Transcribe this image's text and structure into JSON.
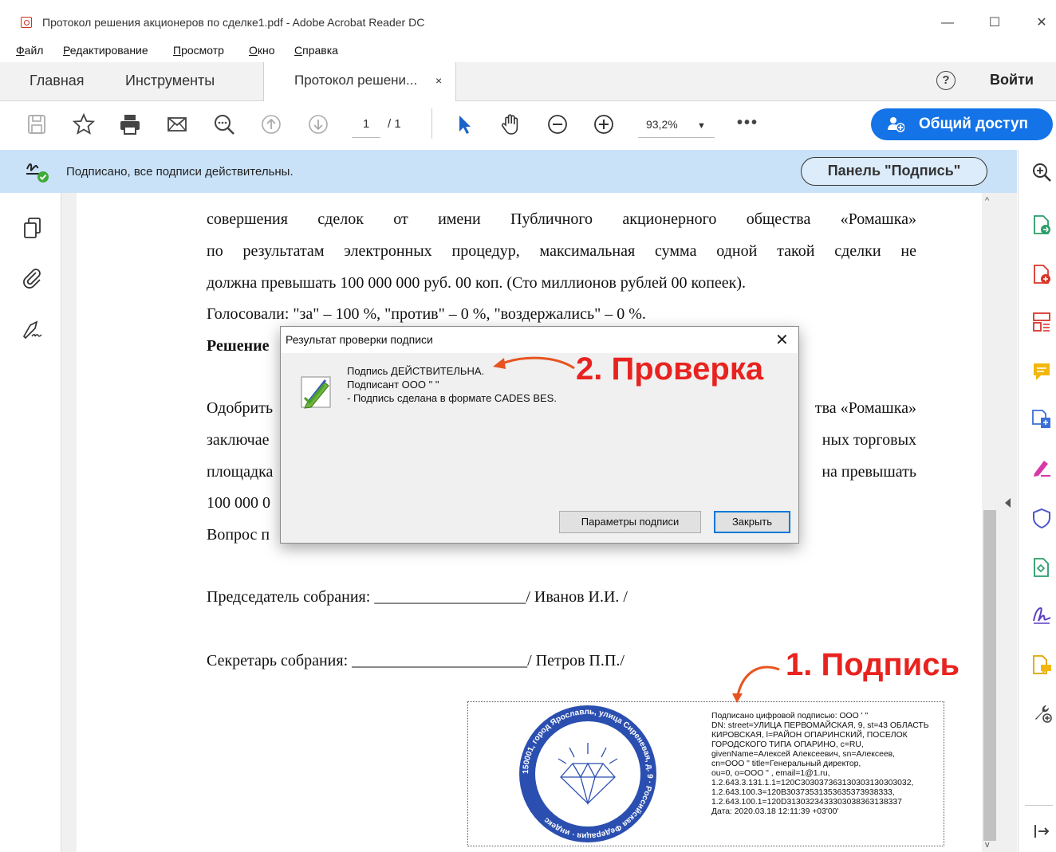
{
  "window": {
    "title": "Протокол решения акционеров по сделке1.pdf - Adobe Acrobat Reader DC",
    "minimize": "—",
    "maximize": "☐",
    "close": "✕"
  },
  "menu": [
    "Файл",
    "Редактирование",
    "Просмотр",
    "Окно",
    "Справка"
  ],
  "tabs": {
    "home": "Главная",
    "tools": "Инструменты",
    "document": "Протокол решени...",
    "document_close": "×",
    "help": "?",
    "login": "Войти"
  },
  "toolbar": {
    "page_current": "1",
    "page_total": "/ 1",
    "zoom": "93,2%",
    "zoom_caret": "▼",
    "more": "•••",
    "share": "Общий доступ"
  },
  "signature_bar": {
    "status": "Подписано, все подписи действительны.",
    "panel_button": "Панель \"Подпись\""
  },
  "document": {
    "lines": [
      "совершения сделок от имени Публичного акционерного общества «Ромашка»",
      "по результатам электронных процедур, максимальная сумма одной такой сделки не",
      "должна превышать 100 000 000 руб. 00 коп. (Сто миллионов рублей 00 копеек).",
      "Голосовали: \"за\" – 100 %, \"против\" – 0 %, \"воздержались\" – 0 %."
    ],
    "partial_left": [
      "Решение",
      "Одобрить",
      "заключае",
      "площадка",
      "100 000 0",
      "Вопрос п"
    ],
    "partial_right": [
      "тва «Ромашка»",
      "ных торговых",
      "на превышать"
    ],
    "chairman": "Председатель собрания: ___________________/ Иванов И.И. /",
    "secretary": "Секретарь собрания: ______________________/ Петров П.П./"
  },
  "dialog": {
    "title": "Результат проверки подписи",
    "close": "✕",
    "line1": "Подпись ДЕЙСТВИТЕЛЬНА.",
    "line2": "Подписант ООО \"                \"",
    "line3": "- Подпись сделана в формате CADES BES.",
    "btn_params": "Параметры подписи",
    "btn_close": "Закрыть"
  },
  "annotations": {
    "check": "2. Проверка",
    "signature": "1. Подпись"
  },
  "signature_stamp": {
    "seal_text": "150001, город Ярославль, улица Сиреневая, д. 9 · Российская Федерация · индекс",
    "details": [
      "Подписано цифровой подписью: ООО '                    \"",
      "DN: street=УЛИЦА ПЕРВОМАЙСКАЯ, 9, st=43 ОБЛАСТЬ",
      "КИРОВСКАЯ, l=РАЙОН ОПАРИНСКИЙ, ПОСЕЛОК",
      "ГОРОДСКОГО ТИПА ОПАРИНО, c=RU,",
      "givenName=Алексей Алексеевич, sn=Алексеев,",
      "cn=ООО \"                  title=Генеральный директор,",
      "ou=0, o=ООО \"                  , email=1@1.ru,",
      "1.2.643.3.131.1.1=120C303037363130303130303032,",
      "1.2.643.100.3=120B30373531353635373938333,",
      "1.2.643.100.1=120D3130323433303038363138337",
      "Дата: 2020.03.18 12:11:39 +03'00'"
    ]
  },
  "colors": {
    "accent": "#1473e6",
    "sigbar": "#c9e2f8",
    "annotation": "#e8231f",
    "seal": "#2b4fb0"
  }
}
